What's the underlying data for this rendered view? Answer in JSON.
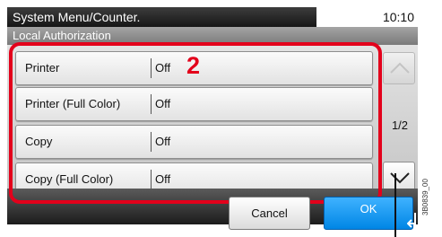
{
  "header": {
    "title": "System Menu/Counter.",
    "time": "10:10",
    "subtitle": "Local Authorization"
  },
  "rows": [
    {
      "label": "Printer",
      "value": "Off"
    },
    {
      "label": "Printer (Full Color)",
      "value": "Off"
    },
    {
      "label": "Copy",
      "value": "Off"
    },
    {
      "label": "Copy (Full Color)",
      "value": "Off"
    }
  ],
  "scroll": {
    "page_indicator": "1/2",
    "up_icon": "chevron-up-icon",
    "down_icon": "chevron-down-icon"
  },
  "buttons": {
    "cancel_label": "Cancel",
    "ok_label": "OK"
  },
  "annotation": {
    "callout": "2",
    "highlight_color": "#e3001b",
    "figure_id": "3B0839_00"
  },
  "colors": {
    "ok_button": "#0086e5",
    "title_bar": "#161616"
  }
}
